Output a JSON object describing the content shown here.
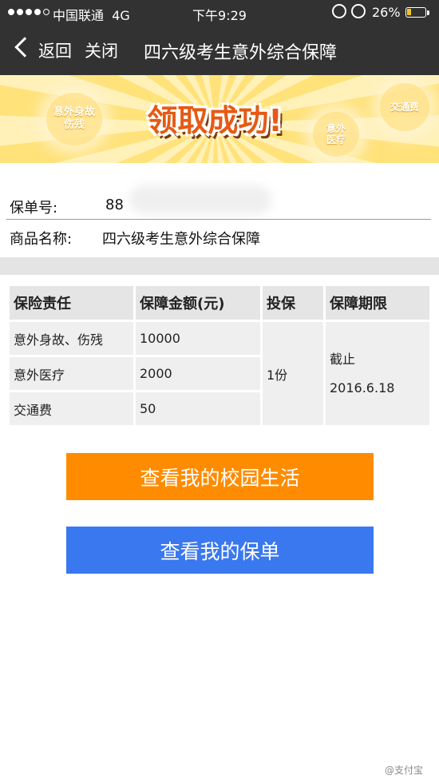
{
  "status_bar": {
    "carrier": "中国联通",
    "network": "4G",
    "time": "下午9:29",
    "battery": "26%",
    "battery_level": 0.26,
    "signal_bars": 4
  },
  "nav": {
    "back_label": "返回",
    "close_label": "关闭",
    "title": "四六级考生意外综合保障"
  },
  "banner": {
    "title": "领取成功!",
    "tags": [
      "意外身故伤残",
      "意外医疗",
      "交通费"
    ]
  },
  "policy": {
    "number_label": "保单号:",
    "number_value": "88",
    "product_label": "商品名称:",
    "product_value": "四六级考生意外综合保障"
  },
  "coverage_table": {
    "headers": [
      "保险责任",
      "保障金额(元)",
      "投保",
      "保障期限"
    ],
    "rows": [
      {
        "item": "意外身故、伤残",
        "amount": "10000"
      },
      {
        "item": "意外医疗",
        "amount": "2000"
      },
      {
        "item": "交通费",
        "amount": "50"
      }
    ],
    "quantity": "1份",
    "period_line1": "截止",
    "period_line2": "2016.6.18"
  },
  "buttons": {
    "campus_life": "查看我的校园生活",
    "my_policy": "查看我的保单"
  },
  "colors": {
    "nav_bg": "#323232",
    "orange_button": "#ff8c00",
    "blue_button": "#3a78f0",
    "banner_title": "#e55a14"
  },
  "watermark": "@支付宝"
}
